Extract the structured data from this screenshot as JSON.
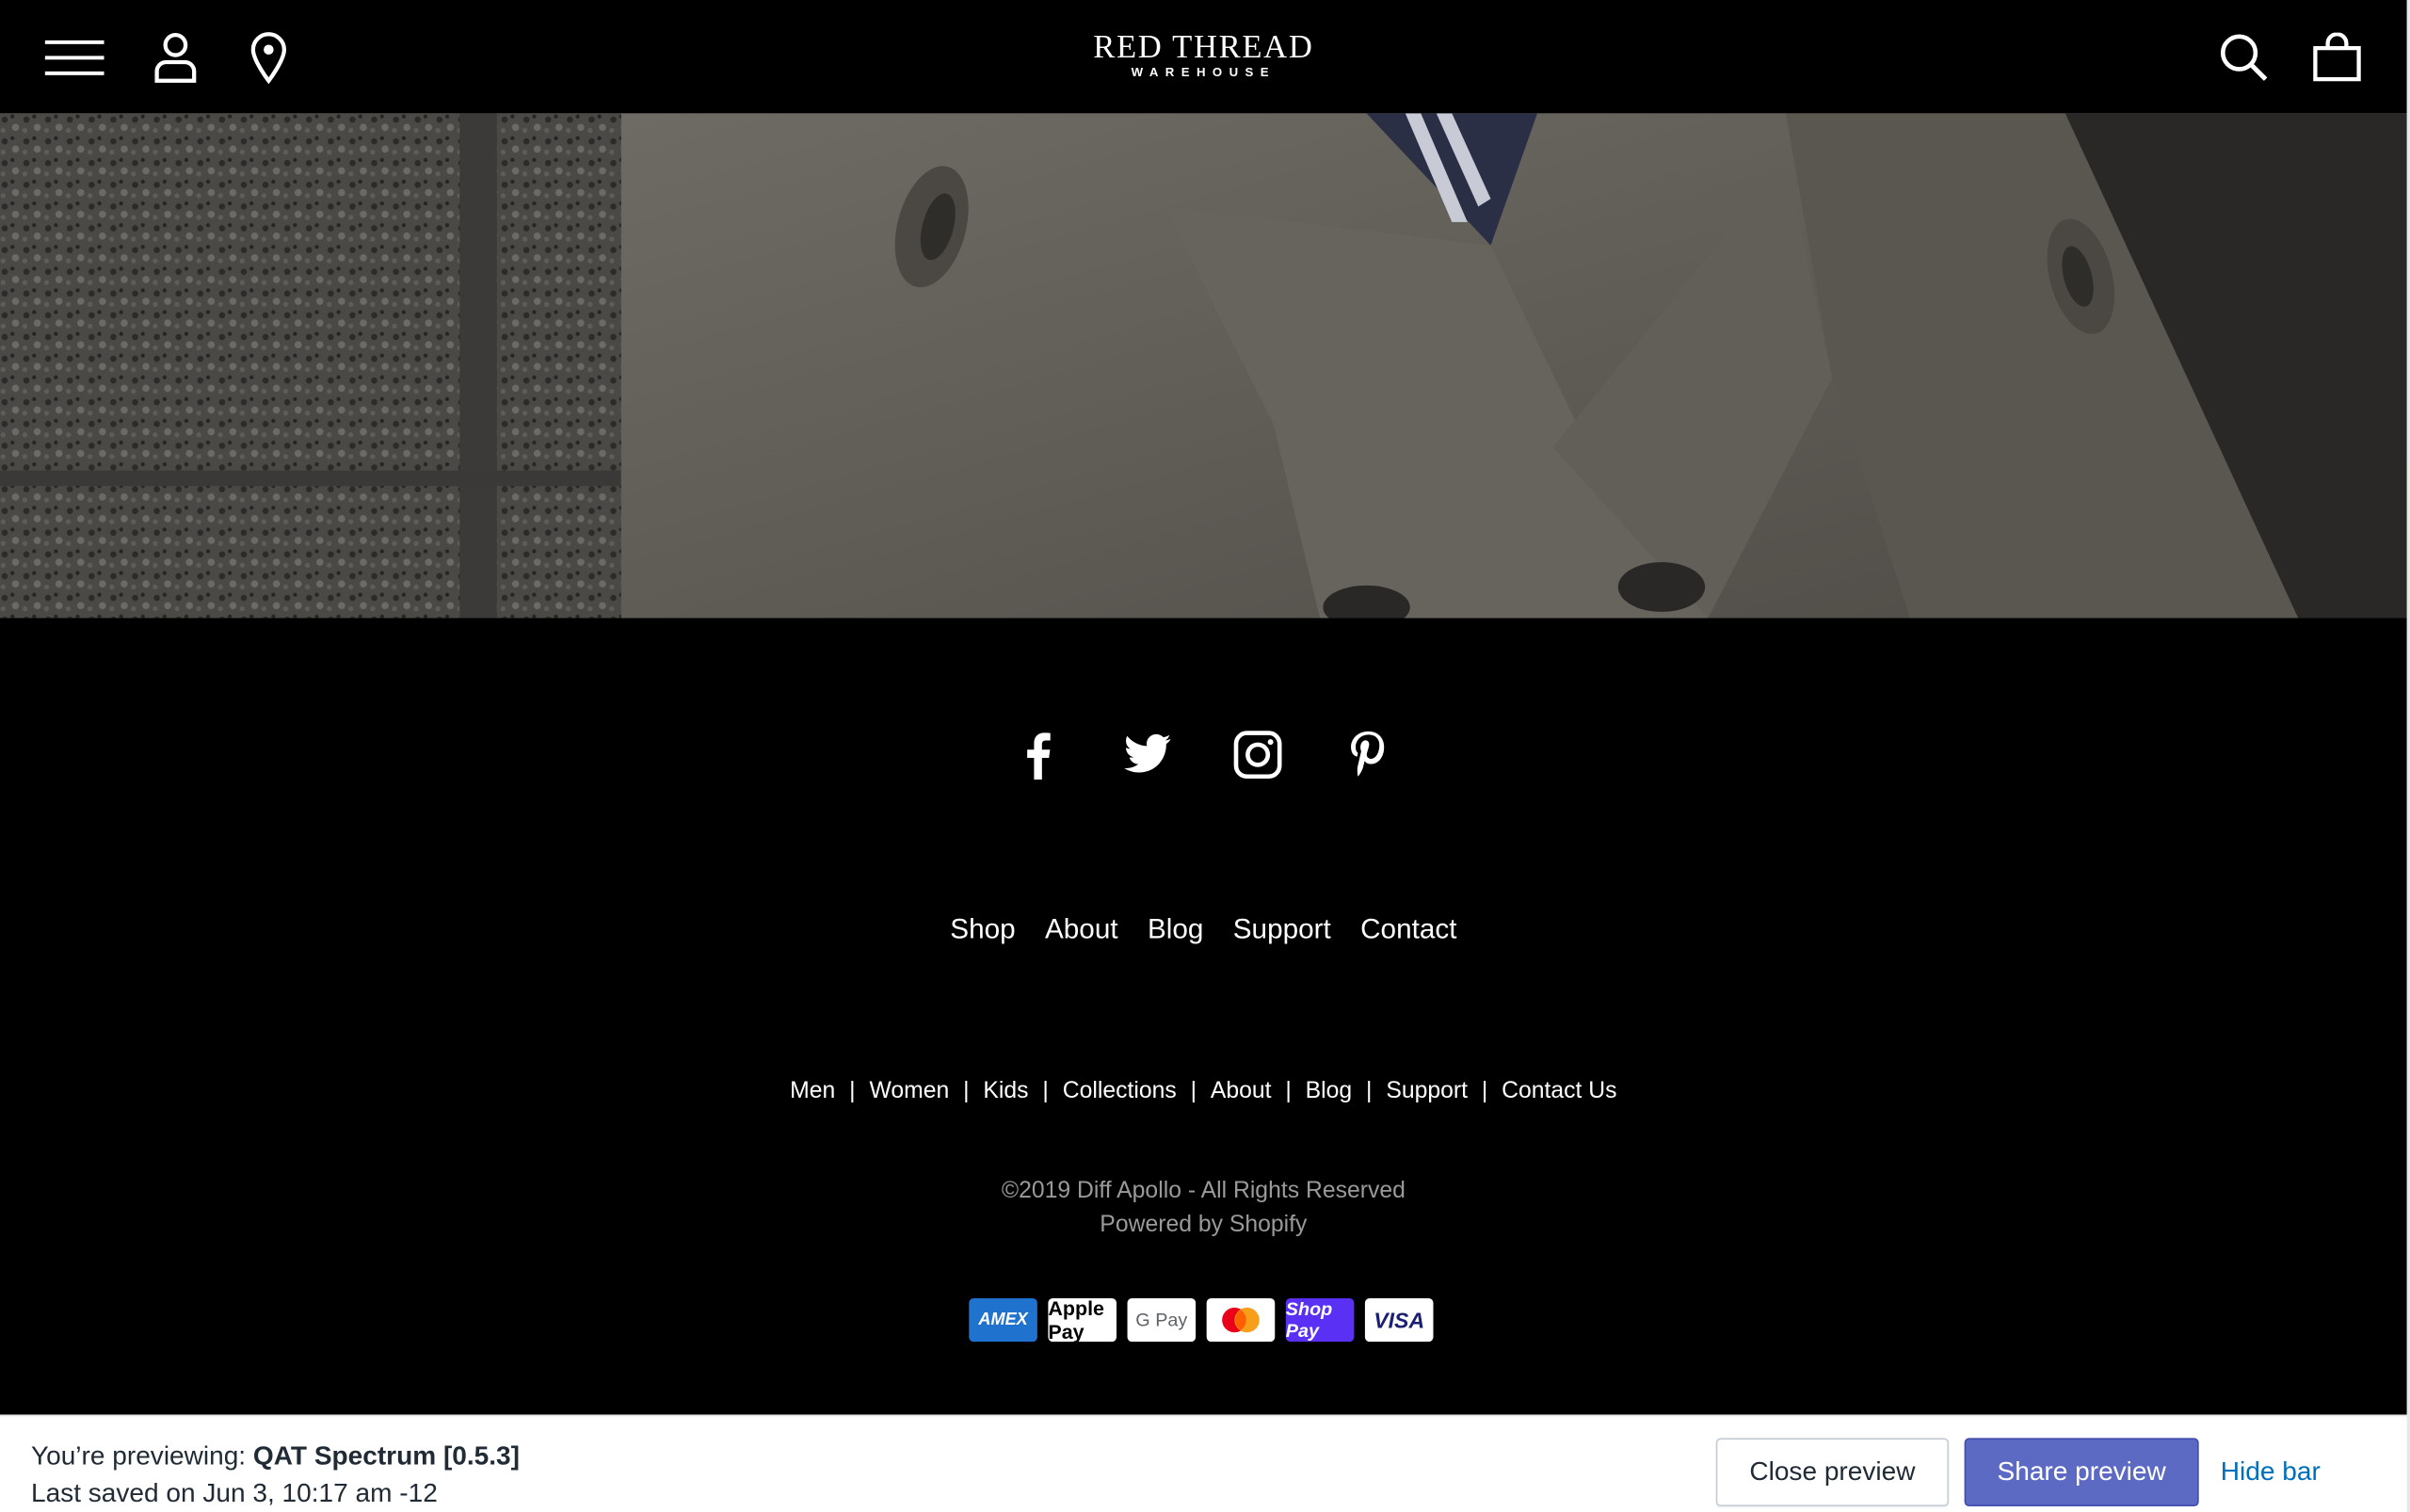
{
  "header": {
    "logo_main": "RED THREAD",
    "logo_sub": "WAREHOUSE",
    "icons": [
      "menu-icon",
      "account-icon",
      "location-icon",
      "search-icon",
      "cart-icon"
    ]
  },
  "social": [
    "facebook-icon",
    "twitter-icon",
    "instagram-icon",
    "pinterest-icon"
  ],
  "primary_nav": [
    "Shop",
    "About",
    "Blog",
    "Support",
    "Contact"
  ],
  "secondary_nav": [
    "Men",
    "Women",
    "Kids",
    "Collections",
    "About",
    "Blog",
    "Support",
    "Contact Us"
  ],
  "footer": {
    "copyright": "©2019 Diff Apollo - All Rights Reserved",
    "powered": "Powered by Shopify"
  },
  "payments": [
    "AMEX",
    "Apple Pay",
    "G Pay",
    "Mastercard",
    "Shop Pay",
    "VISA"
  ],
  "preview_bar": {
    "previewing_label": "You’re previewing:",
    "theme_name": "QAT Spectrum [0.5.3]",
    "last_saved": "Last saved on Jun 3, 10:17 am -12",
    "close_label": "Close preview",
    "share_label": "Share preview",
    "hide_label": "Hide bar"
  },
  "colors": {
    "header_bg": "#000000",
    "share_button": "#5c6ac4",
    "link_blue": "#006fbb"
  }
}
